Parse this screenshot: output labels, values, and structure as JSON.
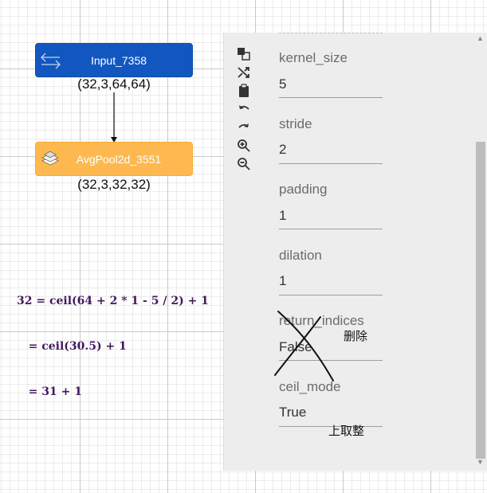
{
  "graph": {
    "nodes": [
      {
        "name": "Input_7358",
        "output_shape": "(32,3,64,64)",
        "color": "#1257c0",
        "icon": "swap-arrows-icon"
      },
      {
        "name": "AvgPool2d_3551",
        "output_shape": "(32,3,32,32)",
        "color": "#fdb94f",
        "icon": "layers-icon"
      }
    ]
  },
  "annotation": {
    "formula_lines": [
      "32 = ceil(64 + 2 * 1 - 5 / 2) + 1",
      "   = ceil(30.5) + 1",
      "   = 31 + 1"
    ],
    "color": "#43185d"
  },
  "toolbar": {
    "icons": [
      "duplicate-icon",
      "shuffle-icon",
      "paste-icon",
      "undo-icon",
      "redo-icon",
      "zoom-in-icon",
      "zoom-out-icon"
    ]
  },
  "properties": [
    {
      "label": "kernel_size",
      "value": "5"
    },
    {
      "label": "stride",
      "value": "2"
    },
    {
      "label": "padding",
      "value": "1"
    },
    {
      "label": "dilation",
      "value": "1"
    },
    {
      "label": "return_indices",
      "value": "False"
    },
    {
      "label": "ceil_mode",
      "value": "True"
    }
  ],
  "handwritten_notes": {
    "delete": "删除",
    "ceil": "上取整"
  }
}
